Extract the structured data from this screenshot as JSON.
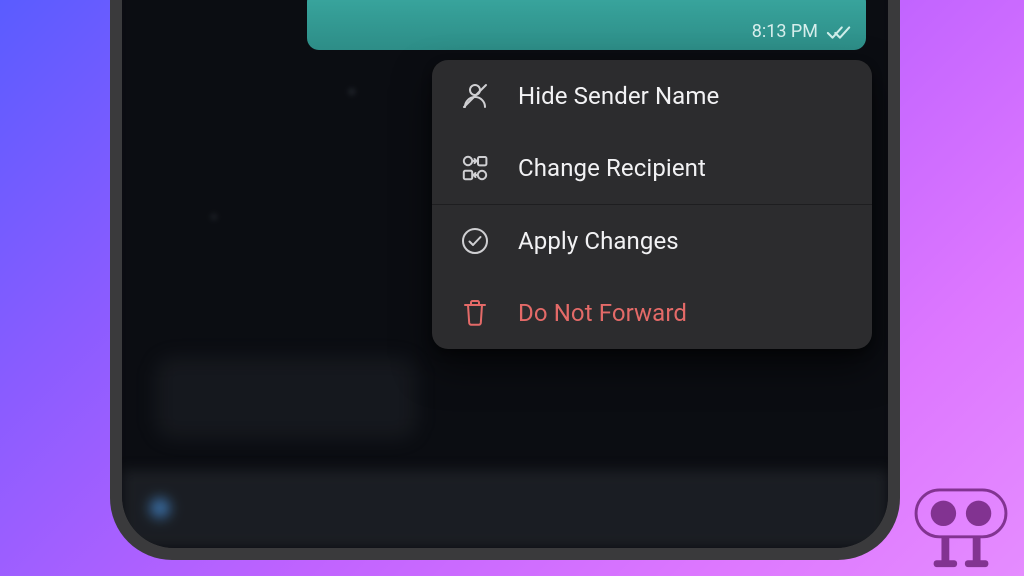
{
  "message": {
    "time": "8:13 PM"
  },
  "menu": {
    "items": [
      {
        "label": "Hide Sender Name"
      },
      {
        "label": "Change Recipient"
      },
      {
        "label": "Apply Changes"
      },
      {
        "label": "Do Not Forward"
      }
    ]
  },
  "colors": {
    "menu_bg": "#2c2c2e",
    "text": "#f2f2f4",
    "danger": "#e46a68",
    "bubble": "#2d8d87"
  }
}
